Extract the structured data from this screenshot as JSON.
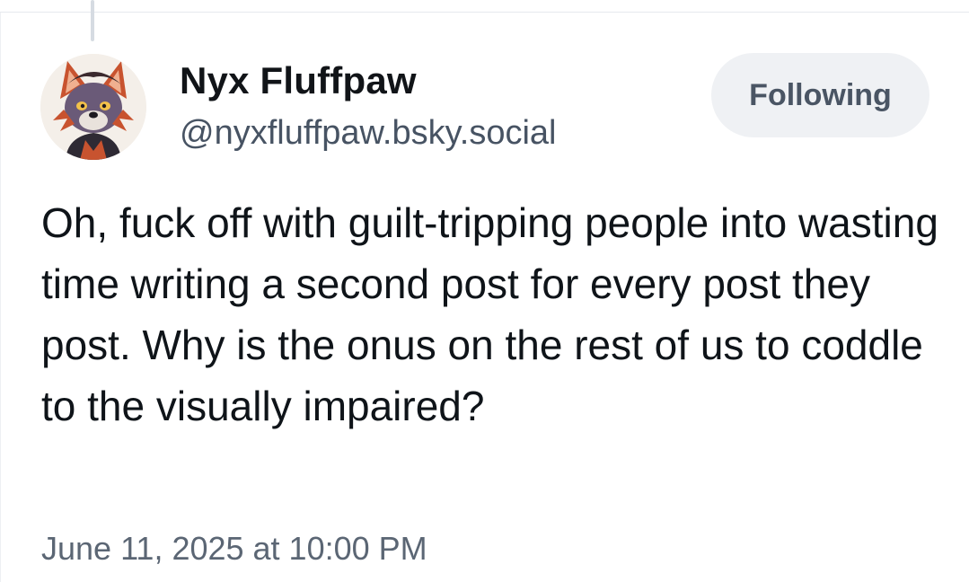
{
  "post": {
    "author": {
      "display_name": "Nyx Fluffpaw",
      "handle": "@nyxfluffpaw.bsky.social",
      "avatar_icon": "fox-character-avatar"
    },
    "follow_button_label": "Following",
    "text": "Oh, fuck off with guilt-tripping people into wasting time writing a second post for every post they post. Why is the onus on the rest of us to coddle to the visually impaired?",
    "timestamp": "June 11, 2025 at 10:00 PM"
  },
  "colors": {
    "text_primary": "#0f1419",
    "text_secondary": "#475363",
    "button_bg": "#eff1f4",
    "button_text": "#4a5564"
  }
}
